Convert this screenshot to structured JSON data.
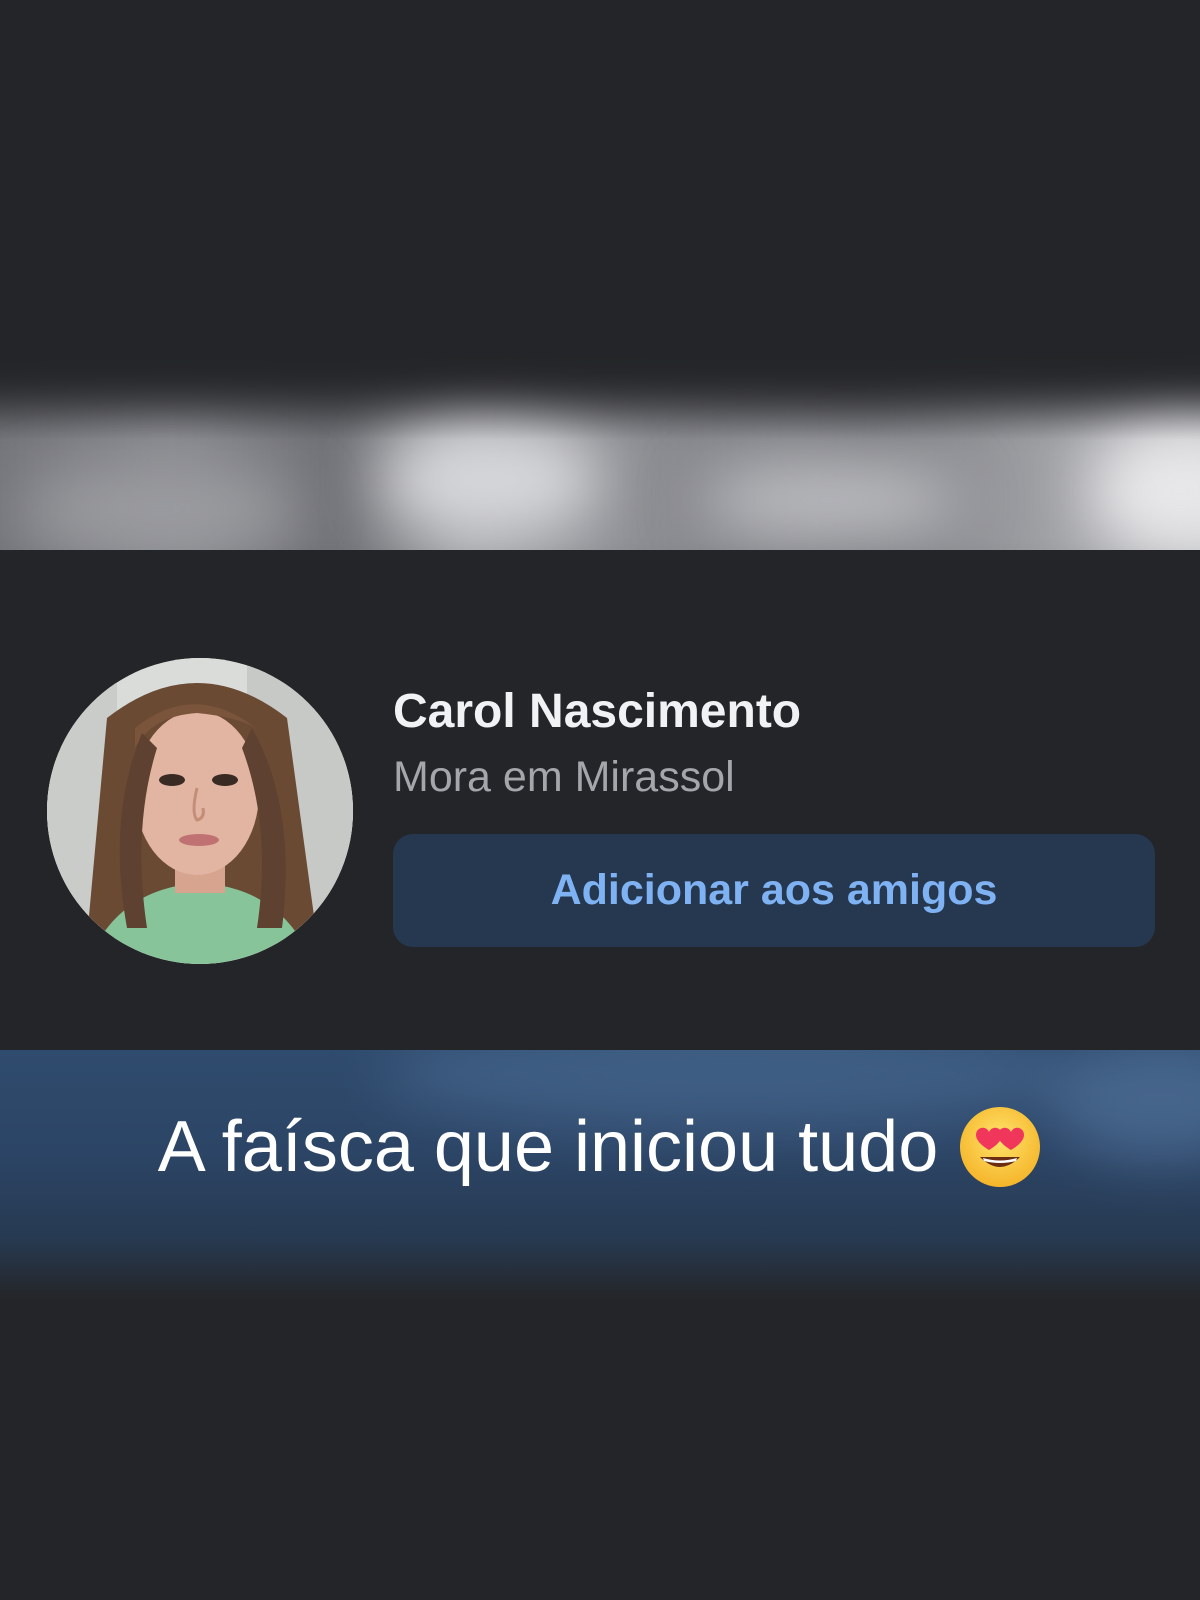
{
  "profile": {
    "name": "Carol Nascimento",
    "location": "Mora em Mirassol",
    "add_friend_label": "Adicionar aos amigos"
  },
  "caption": {
    "text": "A faísca que iniciou tudo",
    "emoji": "heart-eyes-emoji"
  },
  "colors": {
    "background": "#242528",
    "button_bg": "#263850",
    "button_text": "#7fb2f3",
    "name_text": "#f1f2f4",
    "secondary_text": "#a4a6ab"
  }
}
